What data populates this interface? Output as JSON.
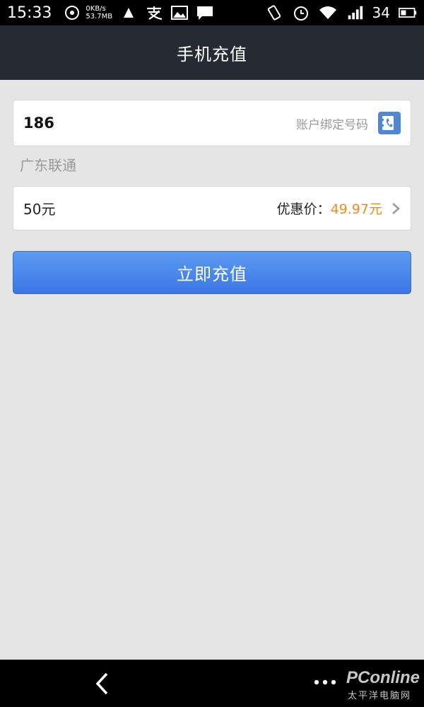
{
  "status_bar": {
    "time": "15:33",
    "net_speed_rate": "0KB/s",
    "net_speed_total": "53.7MB",
    "battery": "34",
    "icons": [
      "data-saver-icon",
      "app-notification-icon",
      "alipay-icon",
      "image-icon",
      "message-icon",
      "rotate-icon",
      "alarm-icon",
      "wifi-icon",
      "signal-3g-icon",
      "battery-icon"
    ]
  },
  "header": {
    "title": "手机充值"
  },
  "phone": {
    "number": "186",
    "bind_hint": "账户绑定号码",
    "contact_icon": "contact-phone-icon"
  },
  "carrier": "广东联通",
  "amount": {
    "value": "50元",
    "discount_label": "优惠价：",
    "discount_price": "49.97元"
  },
  "recharge_button": "立即充值",
  "colors": {
    "header_bg": "#262a33",
    "button_blue": "#3a77e4",
    "price_orange": "#f08c1c",
    "page_bg": "#e5e5e5"
  }
}
